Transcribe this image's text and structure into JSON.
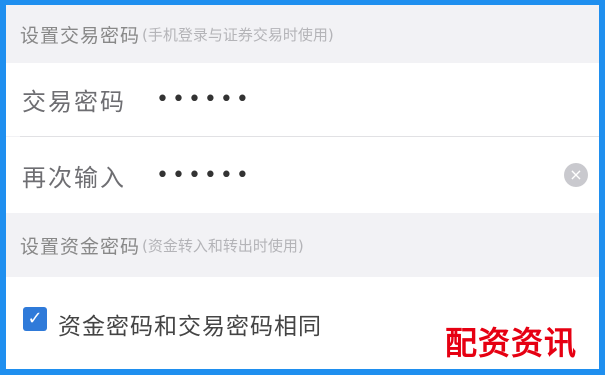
{
  "section_trade": {
    "title": "设置交易密码",
    "note": "(手机登录与证券交易时使用)"
  },
  "trade_password": {
    "label": "交易密码",
    "value": "••••••"
  },
  "confirm_password": {
    "label": "再次输入",
    "value": "••••••",
    "clear_glyph": "×"
  },
  "section_fund": {
    "title": "设置资金密码",
    "note": "(资金转入和转出时使用)"
  },
  "same_password": {
    "label": "资金密码和交易密码相同",
    "checked": true,
    "check_glyph": "✓"
  },
  "watermark": "配资资讯",
  "colors": {
    "frame_border": "#1f8fef",
    "checkbox": "#2f7ad9",
    "watermark": "#e60012"
  }
}
